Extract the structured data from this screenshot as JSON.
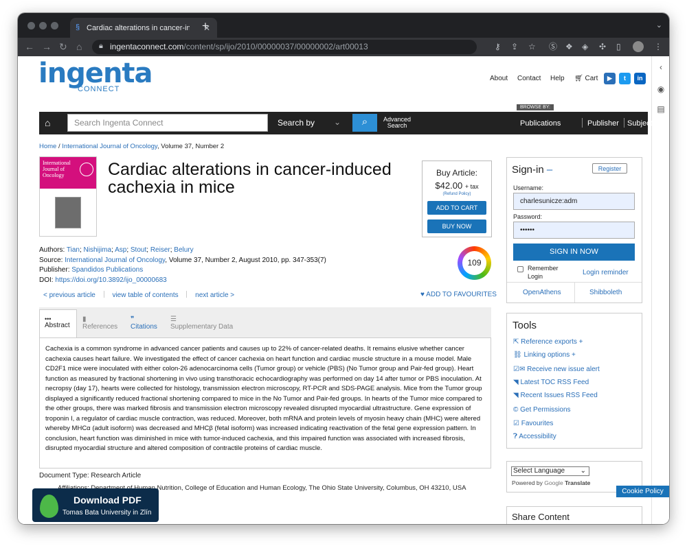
{
  "browser": {
    "tab_title": "Cardiac alterations in cancer-ind",
    "url_host": "ingentaconnect.com",
    "url_path": "/content/sp/ijo/2010/00000037/00000002/art00013"
  },
  "site": {
    "logo_main": "ingenta",
    "logo_sub": "CONNECT",
    "top_links": [
      "About",
      "Contact",
      "Help",
      "Cart"
    ],
    "browse_by": "BROWSE BY:",
    "search_placeholder": "Search Ingenta Connect",
    "search_by": "Search by",
    "advanced_search": "Advanced Search",
    "nav_links": [
      "Publications",
      "Publisher",
      "Subjects"
    ]
  },
  "breadcrumb": {
    "home": "Home",
    "journal": "International Journal of Oncology",
    "rest": ", Volume 37, Number 2"
  },
  "cover": {
    "journal_name": "International Journal of Oncology"
  },
  "article": {
    "title": "Cardiac alterations in cancer-induced cachexia in mice",
    "authors_label": "Authors:",
    "authors": [
      "Tian",
      "Nishijima",
      "Asp",
      "Stout",
      "Reiser",
      "Belury"
    ],
    "source_label": "Source:",
    "source_journal": "International Journal of Oncology",
    "source_rest": ", Volume 37, Number 2, August 2010, pp. 347-353(7)",
    "publisher_label": "Publisher:",
    "publisher": "Spandidos Publications",
    "doi_label": "DOI:",
    "doi": "https://doi.org/10.3892/ijo_00000683",
    "altmetric": "109",
    "prev": "< previous article",
    "toc": "view table of contents",
    "next": "next article >",
    "favourites": "ADD TO FAVOURITES",
    "tabs": [
      "Abstract",
      "References",
      "Citations",
      "Supplementary Data"
    ],
    "abstract": "Cachexia is a common syndrome in advanced cancer patients and causes up to 22% of cancer-related deaths. It remains elusive whether cancer cachexia causes heart failure. We investigated the effect of cancer cachexia on heart function and cardiac muscle structure in a mouse model. Male CD2F1 mice were inoculated with either colon-26 adenocarcinoma cells (Tumor group) or vehicle (PBS) (No Tumor group and Pair-fed group). Heart function as measured by fractional shortening in vivo using transthoracic echocardiography was performed on day 14 after tumor or PBS inoculation. At necropsy (day 17), hearts were collected for histology, transmission electron microscopy, RT-PCR and SDS-PAGE analysis. Mice from the Tumor group displayed a significantly reduced fractional shortening compared to mice in the No Tumor and Pair-fed groups. In hearts of the Tumor mice compared to the other groups, there was marked fibrosis and transmission electron microscopy revealed disrupted myocardial ultrastructure. Gene expression of troponin I, a regulator of cardiac muscle contraction, was reduced. Moreover, both mRNA and protein levels of myosin heavy chain (MHC) were altered whereby MHCα (adult isoform) was decreased and MHCβ (fetal isoform) was increased indicating reactivation of the fetal gene expression pattern. In conclusion, heart function was diminished in mice with tumor-induced cachexia, and this impaired function was associated with increased fibrosis, disrupted myocardial structure and altered composition of contractile proteins of cardiac muscle.",
    "doc_type": "Document Type: Research Article",
    "affiliations": "Affiliations: Department of Human Nutrition, College of Education and Human Ecology, The Ohio State University, Columbus, OH 43210, USA"
  },
  "buy": {
    "label": "Buy Article:",
    "price": "$42.00",
    "tax": "+ tax",
    "refund": "(Refund Policy)",
    "add_to_cart": "ADD TO CART",
    "buy_now": "BUY NOW"
  },
  "pdf": {
    "label": "Download PDF",
    "institution": "Tomas Bata University in Zlín"
  },
  "signin": {
    "title": "Sign-in",
    "register": "Register",
    "username_label": "Username:",
    "username_value": "charlesunicze:adm",
    "password_label": "Password:",
    "password_value": "••••••",
    "sign_in_now": "SIGN IN NOW",
    "remember": "Remember Login",
    "login_reminder": "Login reminder",
    "openathens": "OpenAthens",
    "shibboleth": "Shibboleth"
  },
  "tools": {
    "title": "Tools",
    "items": [
      "Reference exports +",
      "Linking options +",
      "Receive new issue alert",
      "Latest TOC RSS Feed",
      "Recent Issues RSS Feed",
      "Get Permissions",
      "Favourites",
      "Accessibility"
    ]
  },
  "language": {
    "select": "Select Language",
    "powered_by": "Powered by",
    "google": "Google",
    "translate": "Translate"
  },
  "share": {
    "title": "Share Content"
  },
  "cookie": "Cookie Policy",
  "colors": {
    "brand_blue": "#2a7bc1",
    "nav_dark": "#222222",
    "button_blue": "#1a73b8",
    "cover_magenta": "#d40f7d",
    "pdf_navy": "#0c2c4a"
  }
}
